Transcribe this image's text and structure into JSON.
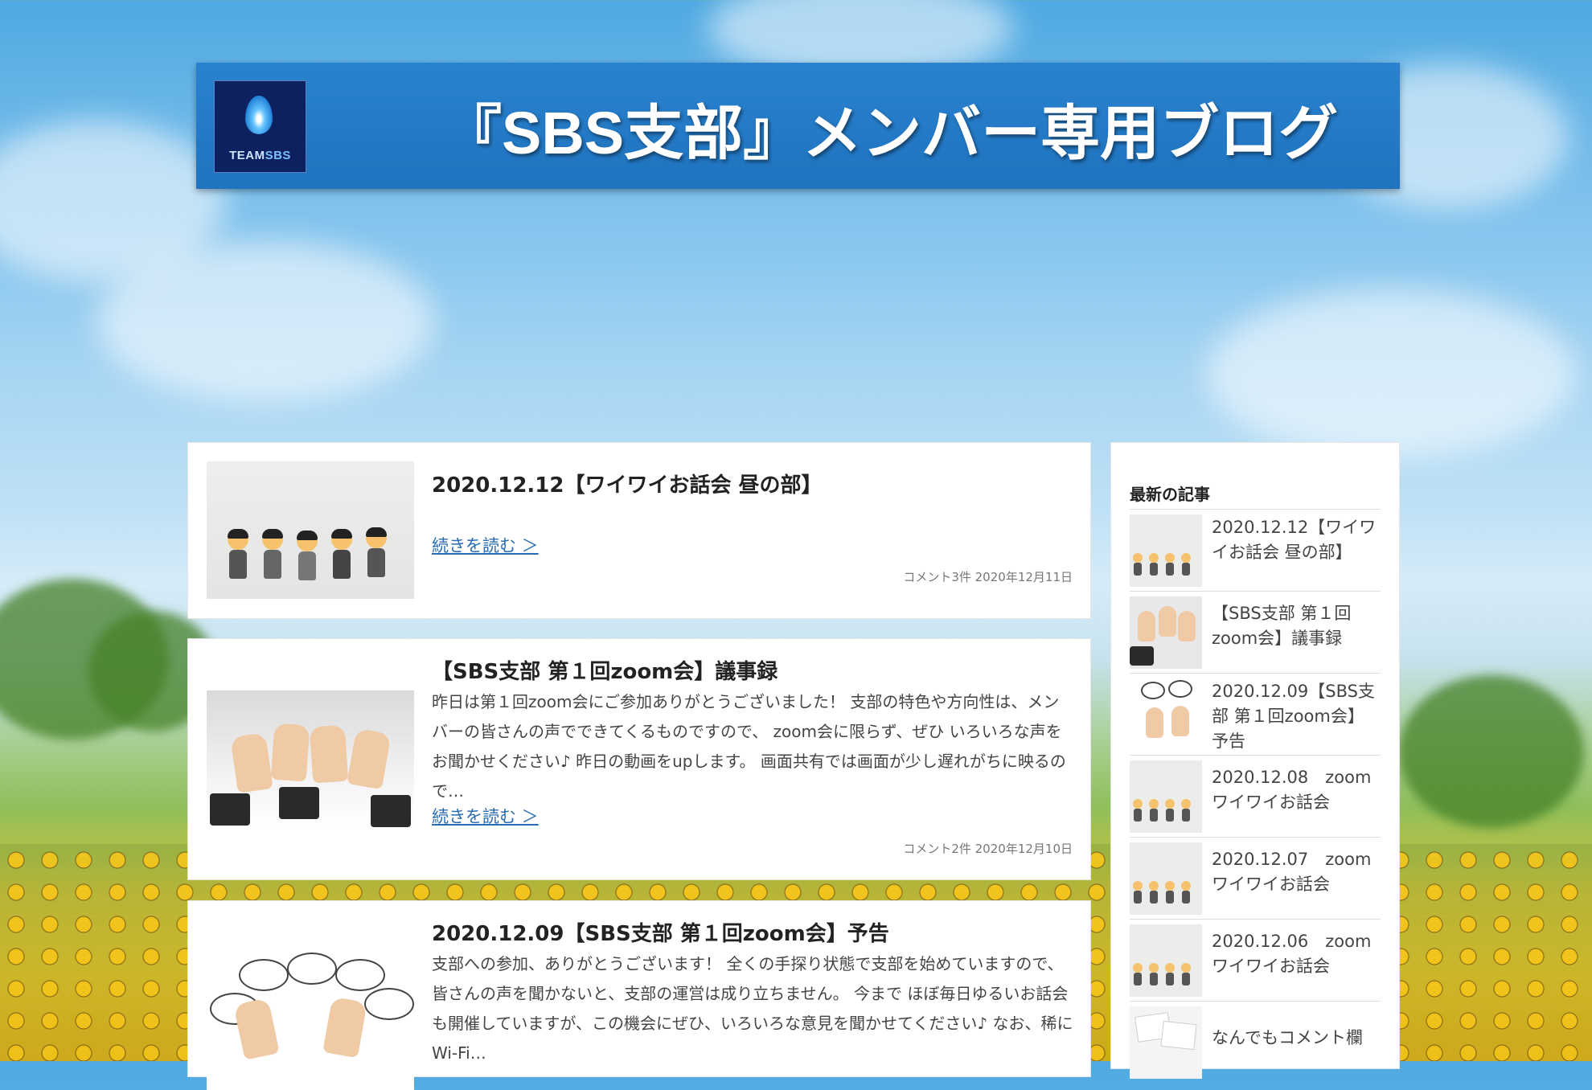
{
  "header": {
    "logo_text_team": "TEAM",
    "logo_text_sbs": "SBS",
    "title": "『SBS支部』メンバー専用ブログ"
  },
  "posts": [
    {
      "title": "2020.12.12【ワイワイお話会 昼の部】",
      "excerpt": "",
      "read_more": "続きを読む ＞",
      "meta": "コメント3件  2020年12月11日",
      "thumb": "people-figures"
    },
    {
      "title": "【SBS支部 第１回zoom会】議事録",
      "excerpt": "昨日は第１回zoom会にご参加ありがとうございました！ 支部の特色や方向性は、メンバーの皆さんの声でできてくるものですので、 zoom会に限らず、ぜひ いろいろな声をお聞かせください♪ 昨日の動画をupします。 画面共有では画面が少し遅れがちに映るので…",
      "read_more": "続きを読む ＞",
      "meta": "コメント2件  2020年12月10日",
      "thumb": "thumbs-up-hands"
    },
    {
      "title": "2020.12.09【SBS支部 第１回zoom会】予告",
      "excerpt": "支部への参加、ありがとうございます！ 全くの手探り状態で支部を始めていますので、皆さんの声を聞かないと、支部の運営は成り立ちません。 今まで ほぼ毎日ゆるいお話会も開催していますが、この機会にぜひ、いろいろな意見を聞かせてください♪ なお、稀にWi-Fi…",
      "thumb": "raised-hands-bubbles"
    }
  ],
  "sidebar": {
    "heading": "最新の記事",
    "items": [
      {
        "label": "2020.12.12【ワイワイお話会 昼の部】",
        "thumb": "people-figures"
      },
      {
        "label": "【SBS支部 第１回zoom会】議事録",
        "thumb": "thumbs-up-hands"
      },
      {
        "label": "2020.12.09【SBS支部 第１回zoom会】予告",
        "thumb": "raised-hands-bubbles"
      },
      {
        "label": "2020.12.08　zoom ワイワイお話会",
        "thumb": "people-figures"
      },
      {
        "label": "2020.12.07　zoom ワイワイお話会",
        "thumb": "people-figures"
      },
      {
        "label": "2020.12.06　zoom ワイワイお話会",
        "thumb": "people-figures"
      },
      {
        "label": "なんでもコメント欄",
        "thumb": "papers"
      }
    ]
  },
  "colors": {
    "header_blue": "#1f73bf",
    "link_blue": "#2a6cb3",
    "logo_navy": "#0d2160"
  }
}
